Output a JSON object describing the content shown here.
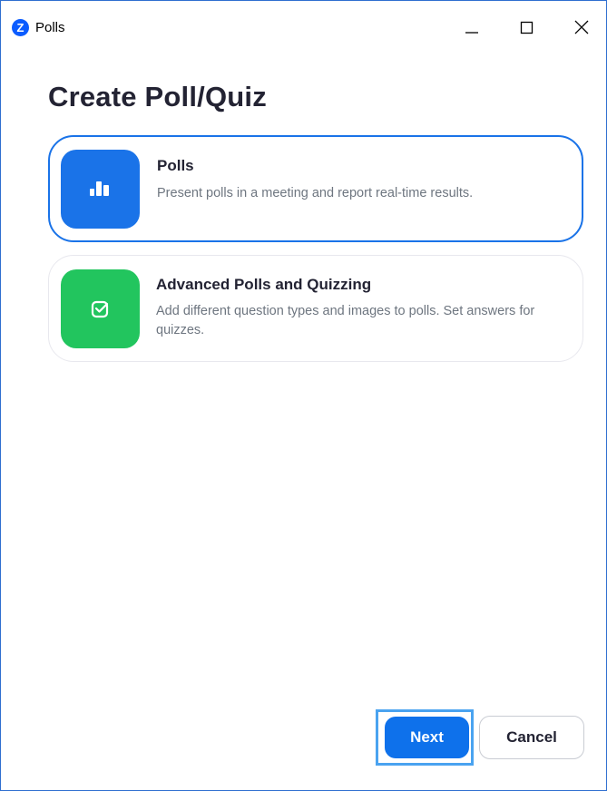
{
  "window": {
    "title": "Polls",
    "app_icon_letter": "Z",
    "accent_color": "#0b5cff"
  },
  "window_controls": {
    "minimize_icon": "minimize-icon",
    "maximize_icon": "maximize-icon",
    "close_icon": "close-icon"
  },
  "main": {
    "title": "Create Poll/Quiz"
  },
  "options": [
    {
      "title": "Polls",
      "description": "Present polls in a meeting and report real-time results.",
      "icon": "bar-chart-icon",
      "tile_color": "#1a73e8",
      "selected": true
    },
    {
      "title": "Advanced Polls and Quizzing",
      "description": "Add different question types and images to polls. Set answers for quizzes.",
      "icon": "checkbox-icon",
      "tile_color": "#22c55e",
      "selected": false
    }
  ],
  "footer": {
    "next_label": "Next",
    "cancel_label": "Cancel",
    "primary_color": "#0e71eb"
  }
}
